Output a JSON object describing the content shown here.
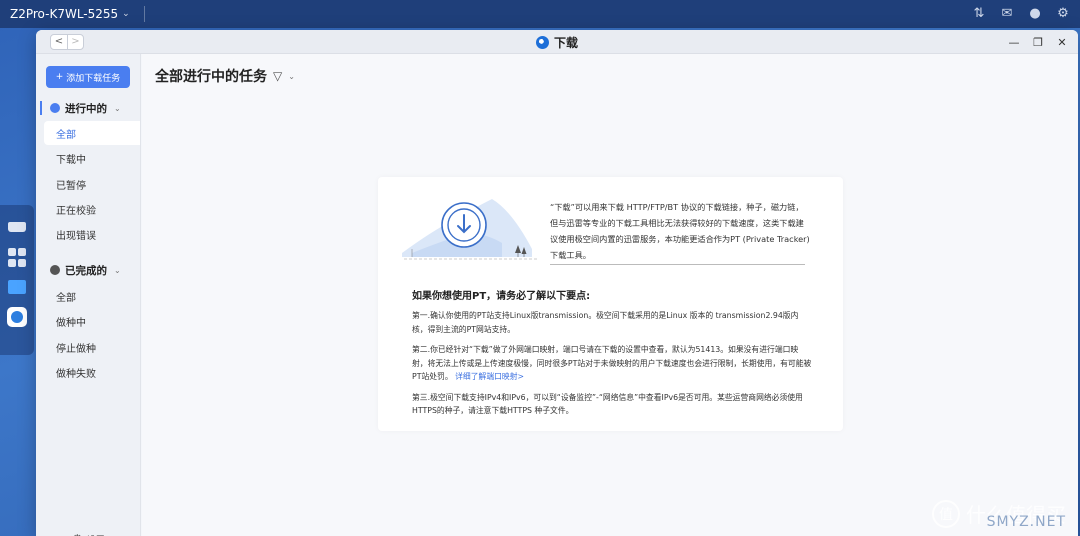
{
  "system": {
    "device_name": "Z2Pro-K7WL-5255",
    "icons": [
      "transfer-icon",
      "mail-icon",
      "user-icon",
      "gear-icon"
    ]
  },
  "dock": {
    "items": [
      "drive-icon",
      "apps-grid-icon",
      "folder-icon",
      "download-app-icon"
    ]
  },
  "window": {
    "title": "下载",
    "back_label": "<",
    "forward_label": ">",
    "minimize_label": "—",
    "restore_label": "❐",
    "close_label": "✕"
  },
  "sidebar": {
    "add_button": "添加下载任务",
    "active_group": {
      "label": "进行中的",
      "items": [
        "全部",
        "下载中",
        "已暂停",
        "正在校验",
        "出现错误"
      ]
    },
    "done_group": {
      "label": "已完成的",
      "items": [
        "全部",
        "做种中",
        "停止做种",
        "做种失败"
      ]
    },
    "settings_label": "设置"
  },
  "main": {
    "title": "全部进行中的任务",
    "card": {
      "intro": "“下载”可以用来下载 HTTP/FTP/BT 协议的下载链接，种子，磁力链，但与迅雷等专业的下载工具相比无法获得较好的下载速度，这类下载建议使用极空间内置的迅雷服务，本功能更适合作为PT (Private Tracker) 下载工具。",
      "heading": "如果你想使用PT，请务必了解以下要点:",
      "p1": "第一.确认你使用的PT站支持Linux版transmission。极空间下载采用的是Linux 版本的 transmission2.94版内核，得到主流的PT网站支持。",
      "p2": "第二.你已经针对“下载”做了外网端口映射，端口号请在下载的设置中查看，默认为51413。如果没有进行端口映射，将无法上传或是上传速度极慢，同时很多PT站对于未做映射的用户下载速度也会进行限制，长期使用，有可能被PT站处罚。",
      "p2_link": "详细了解端口映射>",
      "p3": "第三.极空间下载支持IPv4和IPv6，可以到“设备监控”-“网络信息”中查看IPv6是否可用。某些运营商网络必须使用HTTPS的种子，请注意下载HTTPS 种子文件。"
    }
  },
  "watermark": {
    "logo_char": "值",
    "text": "什么值得买",
    "site": "SMYZ.NET"
  }
}
